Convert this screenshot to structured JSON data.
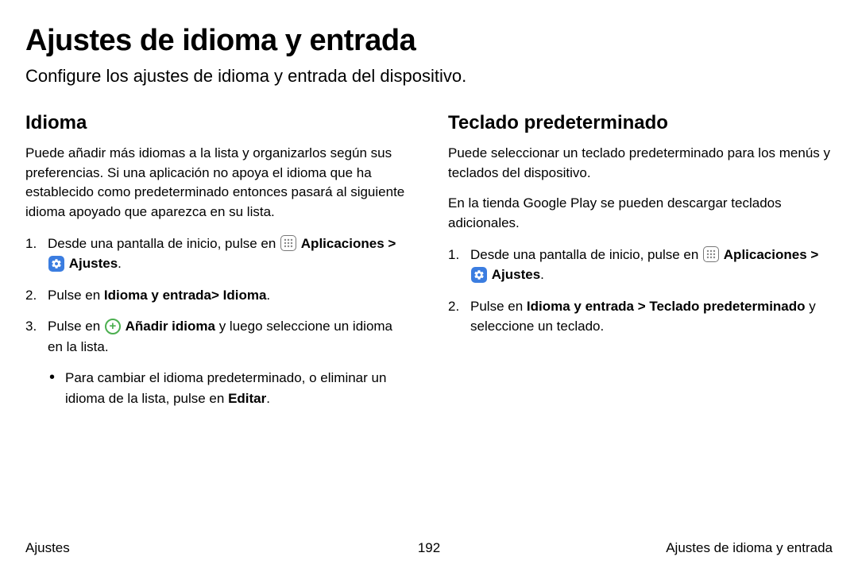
{
  "title": "Ajustes de idioma y entrada",
  "subtitle": "Configure los ajustes de idioma y entrada del dispositivo.",
  "left": {
    "heading": "Idioma",
    "intro": "Puede añadir más idiomas a la lista y organizarlos según sus preferencias. Si una aplicación no apoya el idioma que ha establecido como predeterminado entonces pasará al siguiente idioma apoyado que aparezca en su lista.",
    "step1_prefix": "Desde una pantalla de inicio, pulse en ",
    "step1_apps": "Aplicaciones",
    "step1_sep": " > ",
    "step1_settings": "Ajustes",
    "step1_end": ".",
    "step2_prefix": "Pulse en ",
    "step2_bold": "Idioma y entrada> Idioma",
    "step2_end": ".",
    "step3_prefix": "Pulse en ",
    "step3_bold": "Añadir idioma",
    "step3_suffix": " y luego seleccione un idioma en la lista.",
    "sub_prefix": "Para cambiar el idioma predeterminado, o eliminar un idioma de la lista, pulse en ",
    "sub_bold": "Editar",
    "sub_end": "."
  },
  "right": {
    "heading": "Teclado predeterminado",
    "intro1": "Puede seleccionar un teclado predeterminado para los menús y teclados del dispositivo.",
    "intro2": "En la tienda Google Play se pueden descargar teclados adicionales.",
    "step1_prefix": "Desde una pantalla de inicio, pulse en ",
    "step1_apps": "Aplicaciones",
    "step1_sep": " > ",
    "step1_settings": "Ajustes",
    "step1_end": ".",
    "step2_prefix": "Pulse en ",
    "step2_bold": "Idioma y entrada > Teclado predeterminado",
    "step2_suffix": " y seleccione un teclado."
  },
  "footer": {
    "left": "Ajustes",
    "center": "192",
    "right": "Ajustes de idioma y entrada"
  }
}
